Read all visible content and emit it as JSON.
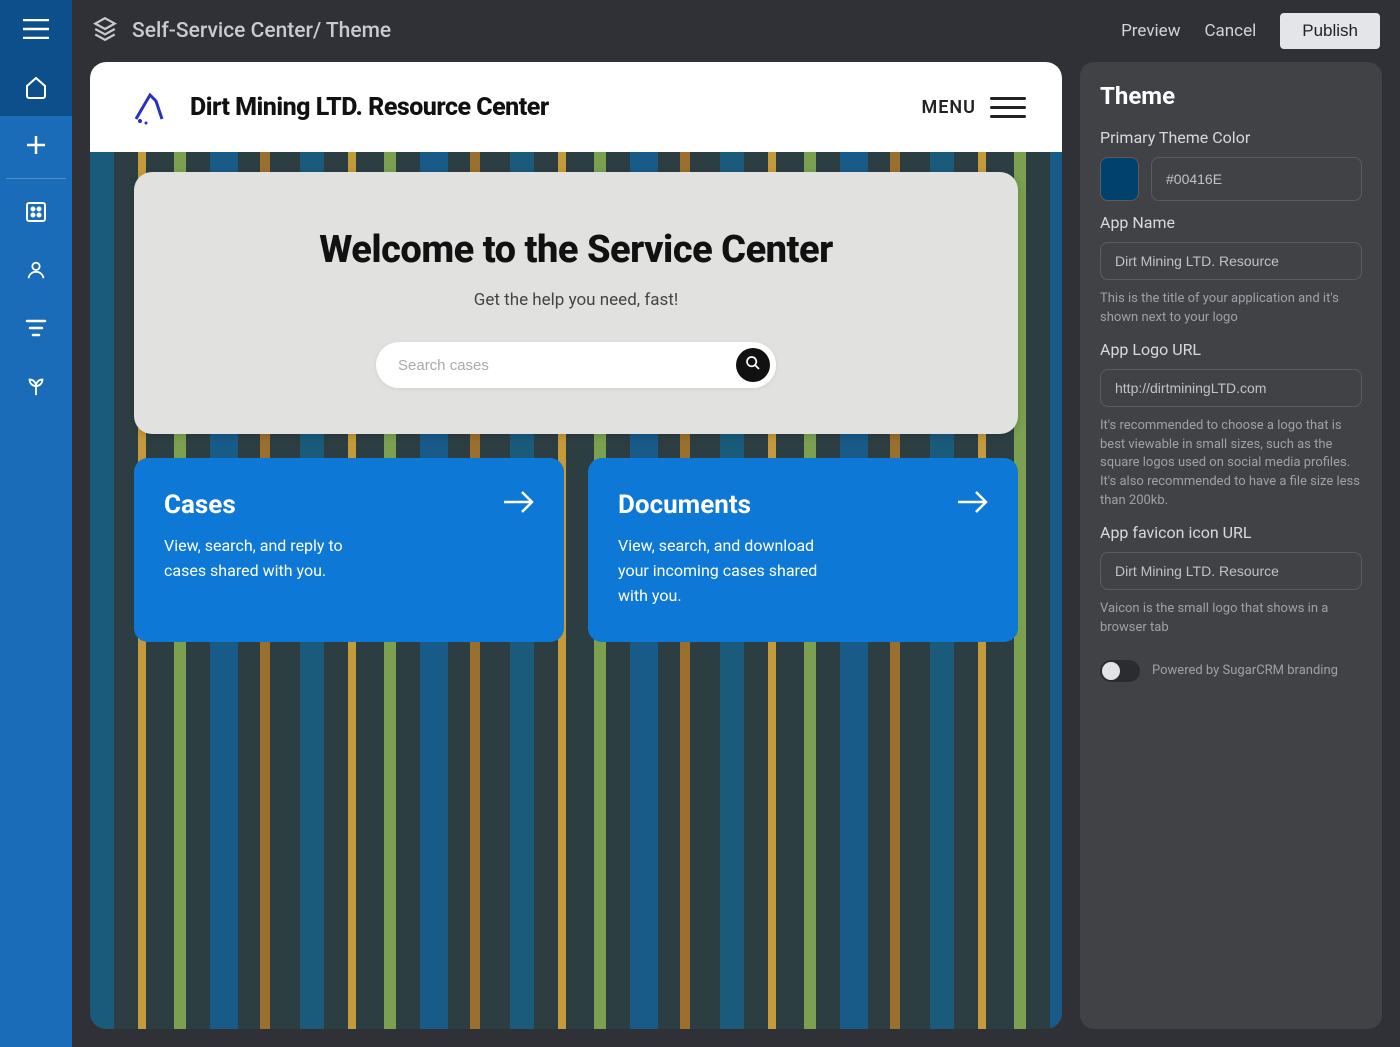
{
  "sidebar": {
    "items": [
      "hamburger",
      "home",
      "add",
      "grid",
      "user",
      "filter",
      "plant"
    ]
  },
  "topbar": {
    "breadcrumb": "Self-Service Center/ Theme",
    "preview": "Preview",
    "cancel": "Cancel",
    "publish": "Publish"
  },
  "preview": {
    "app_title": "Dirt Mining LTD. Resource Center",
    "menu_label": "MENU",
    "hero": {
      "title": "Welcome to the Service Center",
      "subtitle": "Get the help you need, fast!",
      "search_placeholder": "Search cases"
    },
    "cards": [
      {
        "title": "Cases",
        "desc": "View, search, and reply to cases shared with you."
      },
      {
        "title": "Documents",
        "desc": "View, search, and download your incoming cases shared with you."
      }
    ]
  },
  "theme_panel": {
    "title": "Theme",
    "primary_color_label": "Primary Theme Color",
    "primary_color_value": "#00416E",
    "app_name_label": "App Name",
    "app_name_value": "Dirt Mining LTD. Resource",
    "app_name_help": "This is the title of your application and it's shown next to your logo",
    "logo_label": "App Logo URL",
    "logo_value": "http://dirtminingLTD.com",
    "logo_help": "It's recommended to choose a logo that is best viewable in small sizes, such as the square logos used on social media profiles. It's also recommended to have a file size less than 200kb.",
    "favicon_label": "App favicon icon URL",
    "favicon_value": "Dirt Mining LTD. Resource",
    "favicon_help": "Vaicon is the small logo that shows in a browser tab",
    "branding_toggle_label": "Powered by SugarCRM branding"
  }
}
